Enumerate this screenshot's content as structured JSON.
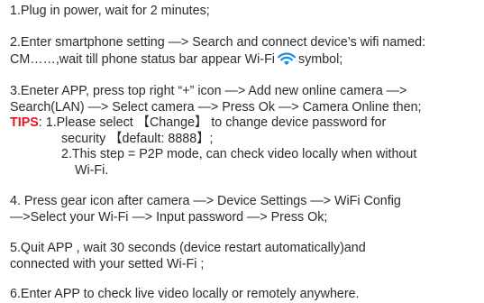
{
  "steps": {
    "s1": "1.Plug in power, wait for 2 minutes;",
    "s2_line1": "2.Enter smartphone setting —> Search and connect device’s wifi named:",
    "s2_line2_a": "CM……,wait till phone status bar appear Wi-Fi",
    "s2_line2_b": "symbol;",
    "s3_line1": "3.Eneter APP, press top right “+” icon —> Add new online camera —>",
    "s3_line2": "Search(LAN) —> Select camera —> Press Ok —> Camera Online then;",
    "s4_line1": "4. Press gear icon after camera —> Device Settings —> WiFi Config",
    "s4_line2": "—>Select your Wi-Fi —> Input password —> Press Ok;",
    "s5_line1": "5.Quit APP , wait 30 seconds (device restart automatically)and",
    "s5_line2": "connected with your setted Wi-Fi ;",
    "s6": "6.Enter APP to check live video locally or remotely anywhere."
  },
  "tips": {
    "label": "TIPS",
    "t1_line1": ": 1.Please select 【Change】 to change device password for",
    "t1_line2": "security 【default: 8888】;",
    "t2_line1": "2.This step = P2P mode, can check video locally when without",
    "t2_line2": "Wi-Fi."
  },
  "icons": {
    "wifi": "wifi-icon",
    "wifi_color": "#1a8fe0"
  },
  "colors": {
    "text": "#2b2b2b",
    "tips": "#e8141b"
  }
}
